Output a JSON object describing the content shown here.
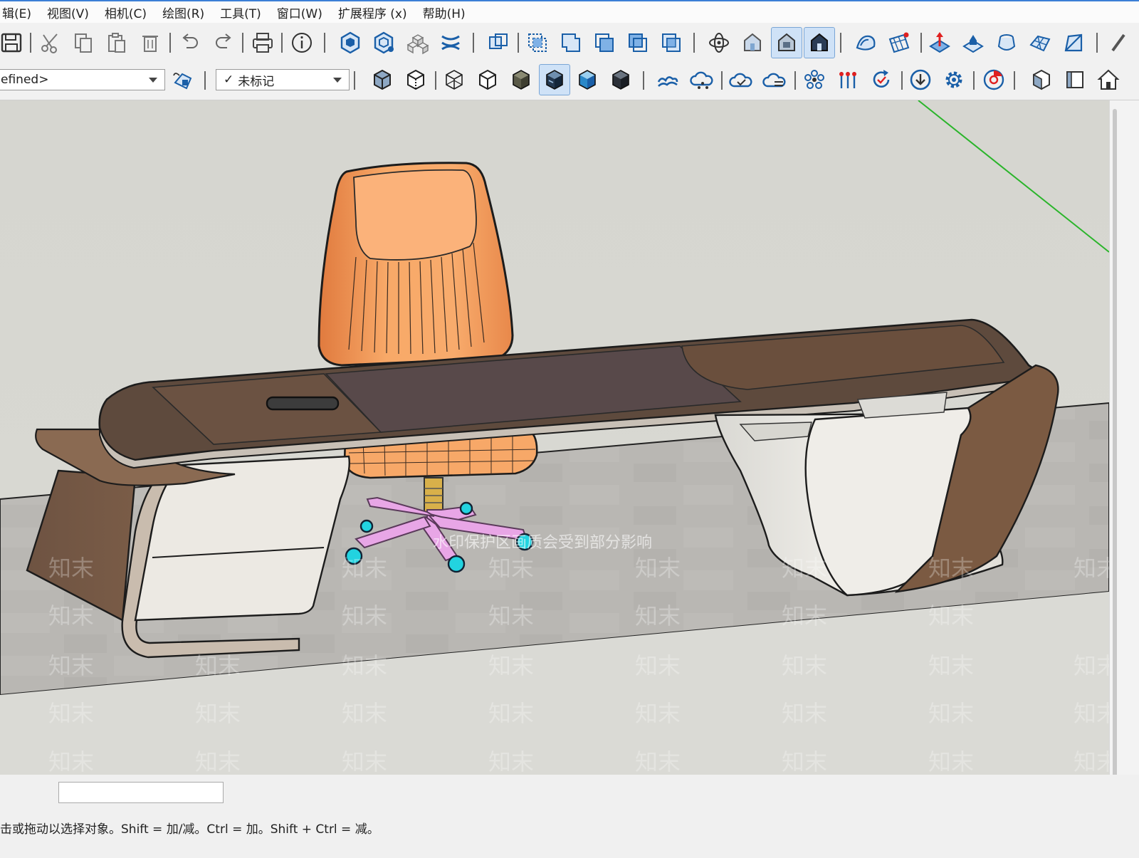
{
  "menu": [
    "编辑(E)",
    "视图(V)",
    "相机(C)",
    "绘图(R)",
    "工具(T)",
    "窗口(W)",
    "扩展程序 (x)",
    "帮助(H)"
  ],
  "menu_visible": [
    "辑(E)",
    "视图(V)",
    "相机(C)",
    "绘图(R)",
    "工具(T)",
    "窗口(W)",
    "扩展程序 (x)",
    "帮助(H)"
  ],
  "toolbar2": {
    "style_dropdown_value": "efined>",
    "tag_dropdown_value": "未标记",
    "tag_check": "✓"
  },
  "viewport": {
    "watermark_text": "知末",
    "notice_text": "水印保护区画质会受到部分影响"
  },
  "status": {
    "hint_text": "击或拖动以选择对象。Shift = 加/减。Ctrl = 加。Shift + Ctrl = 减。"
  },
  "colors": {
    "accent": "#3b7fd6",
    "axis_green": "#2bb52b",
    "chair_orange": "#f8a968",
    "desk_wood": "#6d5341",
    "desk_light": "#ece9e3",
    "base_pink": "#e8a6e6",
    "wheel_cyan": "#22d3e0",
    "icon_blue": "#1a5fa8"
  }
}
